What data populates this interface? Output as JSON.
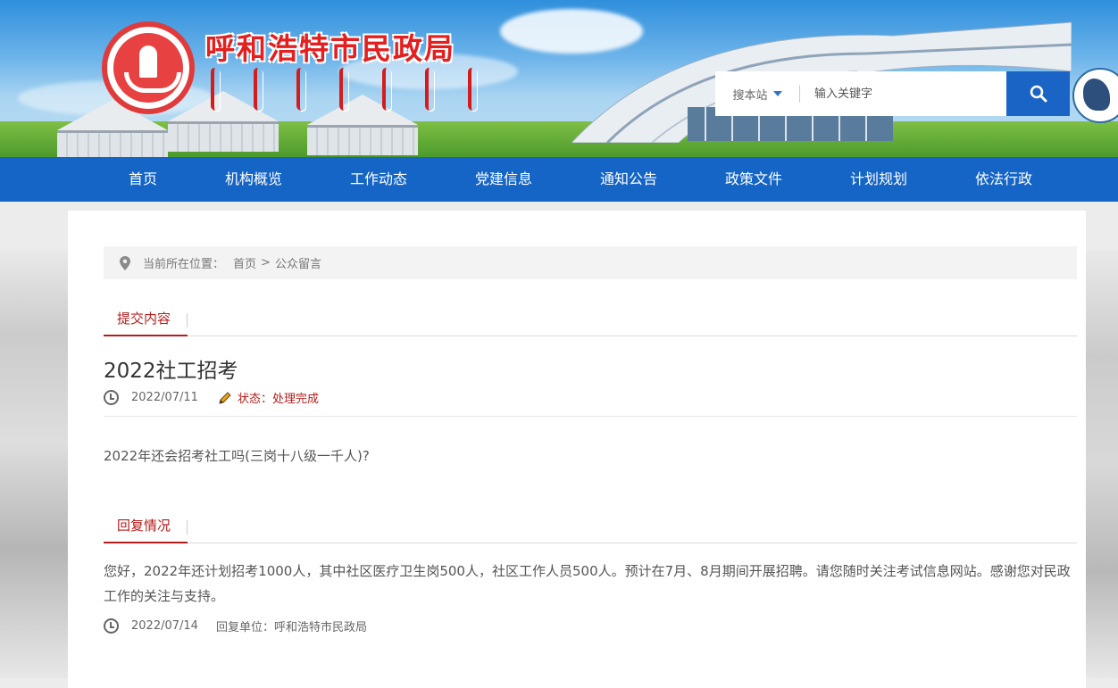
{
  "header": {
    "site_title": "呼和浩特市民政局"
  },
  "search": {
    "scope_label": "搜本站",
    "placeholder": "输入关键字"
  },
  "nav": {
    "items": [
      {
        "label": "首页"
      },
      {
        "label": "机构概览"
      },
      {
        "label": "工作动态"
      },
      {
        "label": "党建信息"
      },
      {
        "label": "通知公告"
      },
      {
        "label": "政策文件"
      },
      {
        "label": "计划规划"
      },
      {
        "label": "依法行政"
      }
    ]
  },
  "breadcrumb": {
    "prefix": "当前所在位置：",
    "home": "首页",
    "separator": ">",
    "current": "公众留言"
  },
  "submission": {
    "tab_label": "提交内容",
    "title": "2022社工招考",
    "date": "2022/07/11",
    "status_label": "状态：",
    "status_value": "处理完成",
    "question": "2022年还会招考社工吗(三岗十八级一千人)?"
  },
  "reply": {
    "tab_label": "回复情况",
    "content": "您好，2022年还计划招考1000人，其中社区医疗卫生岗500人，社区工作人员500人。预计在7月、8月期间开展招聘。请您随时关注考试信息网站。感谢您对民政工作的关注与支持。",
    "date": "2022/07/14",
    "unit_label": "回复单位：",
    "unit_value": "呼和浩特市民政局"
  },
  "colors": {
    "nav_bg": "#1565c6",
    "accent_red": "#b61c1c",
    "search_button": "#1a64c6"
  }
}
